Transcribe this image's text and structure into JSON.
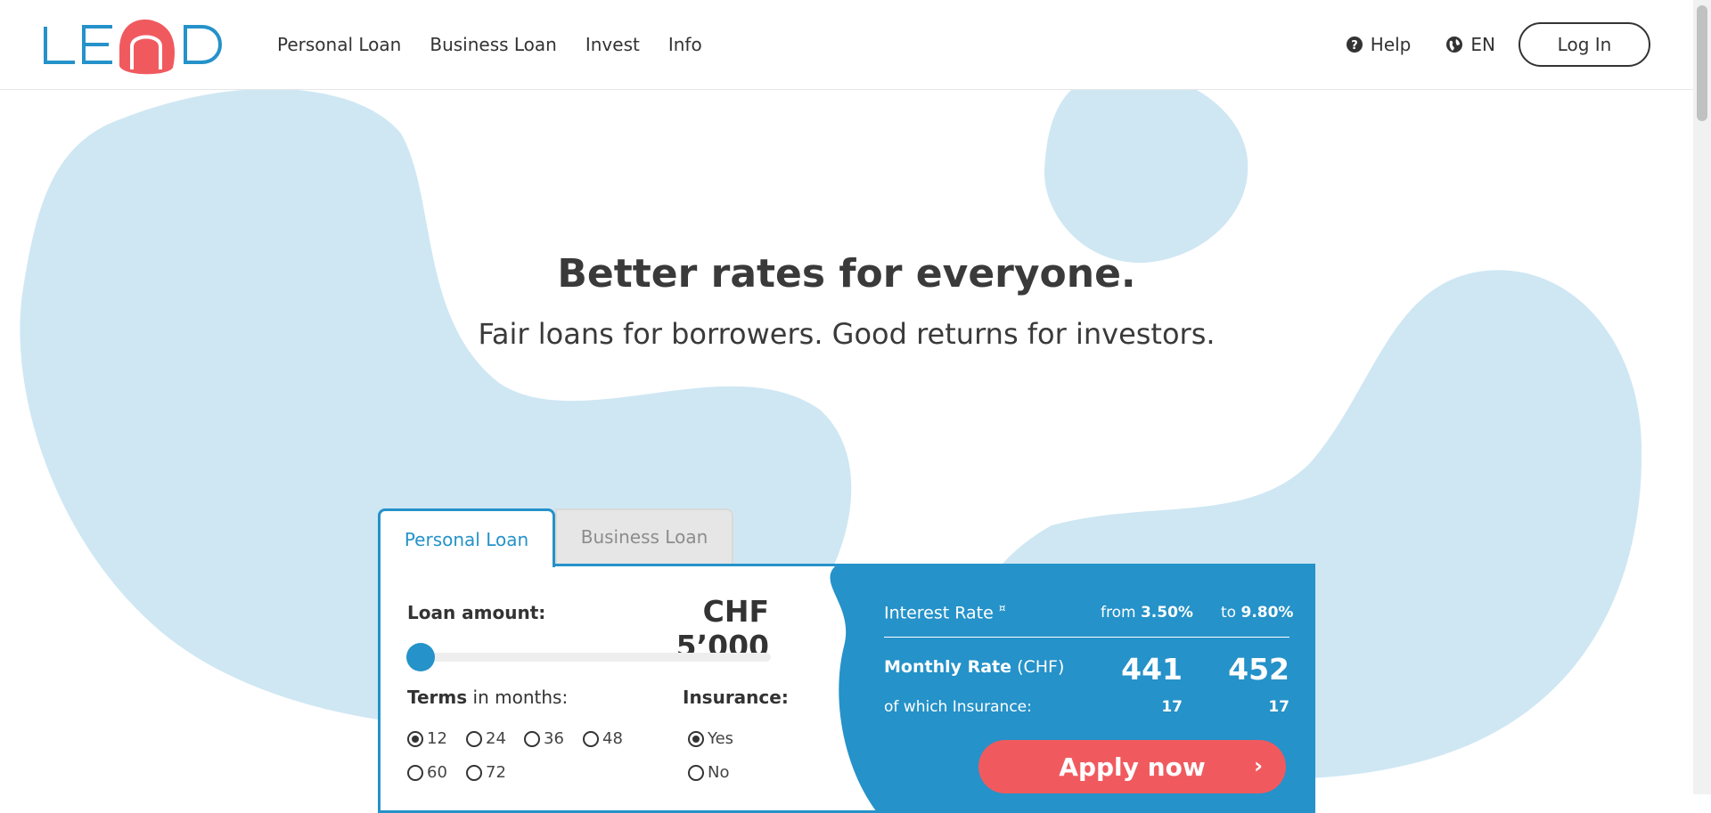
{
  "brand": {
    "logo_text": "LEND",
    "accent": "#2592c9",
    "coral": "#f05a5f",
    "blob": "#cfe7f3"
  },
  "nav": {
    "items": [
      "Personal Loan",
      "Business Loan",
      "Invest",
      "Info"
    ]
  },
  "header_right": {
    "help": "Help",
    "language": "EN",
    "login": "Log In"
  },
  "hero": {
    "title": "Better rates for everyone.",
    "subtitle": "Fair loans for borrowers. Good returns for investors."
  },
  "calculator": {
    "tabs": [
      "Personal Loan",
      "Business Loan"
    ],
    "active_tab": "Personal Loan",
    "amount_label": "Loan amount:",
    "amount_value": "CHF 5’000",
    "slider_level": 0,
    "terms_label_bold": "Terms",
    "terms_label_rest": " in months:",
    "terms": [
      "12",
      "24",
      "36",
      "48",
      "60",
      "72"
    ],
    "selected_term": "12",
    "insurance_label": "Insurance:",
    "insurance": [
      "Yes",
      "No"
    ],
    "selected_insurance": "Yes",
    "interest_label": "Interest Rate",
    "interest_marker": "¤",
    "from_prefix": "from",
    "from_value": "3.50%",
    "to_prefix": "to",
    "to_value": "9.80%",
    "monthly_label": "Monthly Rate",
    "monthly_unit": "(CHF)",
    "monthly_from": "441",
    "monthly_to": "452",
    "insurance_part_label": "of which Insurance:",
    "insurance_from": "17",
    "insurance_to": "17",
    "apply": "Apply now",
    "apply_chevron": "›"
  }
}
